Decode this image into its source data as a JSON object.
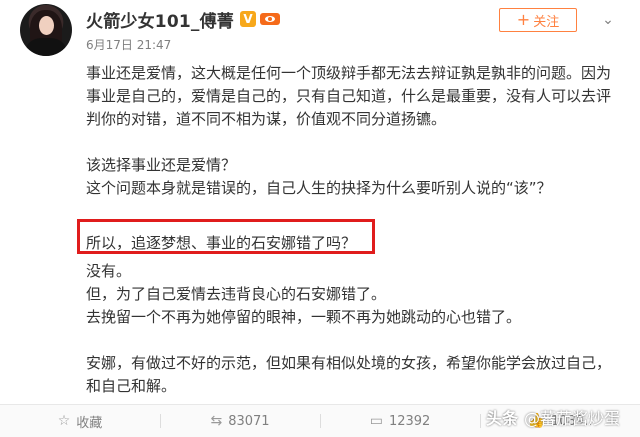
{
  "post": {
    "username": "火箭少女101_傅菁",
    "verified_badge": "V",
    "timestamp": "6月17日 21:47",
    "follow_label": "关注",
    "content": [
      "事业还是爱情，这大概是任何一个顶级辩手都无法去辩证孰是孰非的问题。因为",
      "事业是自己的，爱情是自己的，只有自己知道，什么是最重要，没有人可以去评",
      "判你的对错，道不同不相为谋，价值观不同分道扬镳。",
      "",
      "该选择事业还是爱情？",
      "这个问题本身就是错误的，自己人生的抉择为什么要听别人说的“该”？",
      "",
      "所以，追逐梦想、事业的石安娜错了吗？",
      "没有。",
      "但，为了自己爱情去违背良心的石安娜错了。",
      "去挽留一个不再为她停留的眼神，一颗不再为她跳动的心也错了。",
      "",
      "安娜，有做过不好的示范，但如果有相似处境的女孩，希望你能学会放过自己，",
      "和自己和解。"
    ]
  },
  "actions": {
    "favorite_label": "收藏",
    "repost_count": "83071",
    "comment_count": "12392",
    "like_count": "1089.."
  },
  "watermark": {
    "platform": "头条",
    "account": "@蕃茄酱炒蛋"
  },
  "colors": {
    "accent": "#ff8140",
    "highlight_border": "#e01c1c",
    "verified": "#f7a81b"
  }
}
